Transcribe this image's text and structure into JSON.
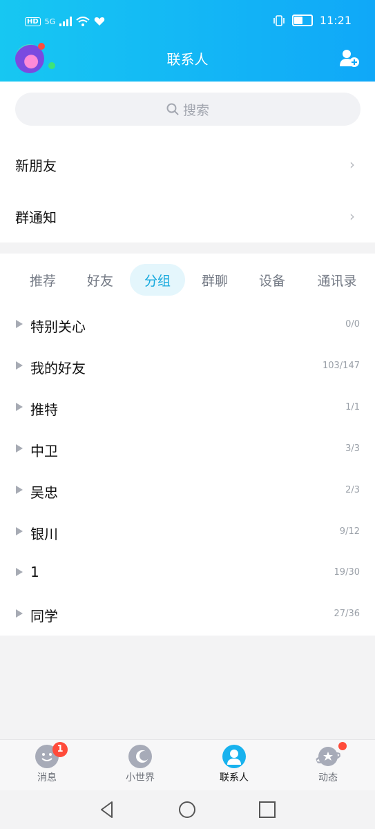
{
  "status_bar": {
    "hd": "HD",
    "net": "5G",
    "time": "11:21"
  },
  "header": {
    "title": "联系人"
  },
  "search": {
    "placeholder": "搜索"
  },
  "entries": [
    {
      "label": "新朋友"
    },
    {
      "label": "群通知"
    }
  ],
  "tabs": [
    {
      "label": "推荐",
      "active": false
    },
    {
      "label": "好友",
      "active": false
    },
    {
      "label": "分组",
      "active": true
    },
    {
      "label": "群聊",
      "active": false
    },
    {
      "label": "设备",
      "active": false
    },
    {
      "label": "通讯录",
      "active": false
    }
  ],
  "groups": [
    {
      "name": "特别关心",
      "count": "0/0"
    },
    {
      "name": "我的好友",
      "count": "103/147"
    },
    {
      "name": "推特",
      "count": "1/1"
    },
    {
      "name": "中卫",
      "count": "3/3"
    },
    {
      "name": "吴忠",
      "count": "2/3"
    },
    {
      "name": "银川",
      "count": "9/12"
    },
    {
      "name": "1",
      "count": "19/30"
    },
    {
      "name": "同学",
      "count": "27/36"
    }
  ],
  "bottom_nav": {
    "messages_badge": "1",
    "items": [
      {
        "label": "消息",
        "icon": "messages-icon"
      },
      {
        "label": "小世界",
        "icon": "small-world-icon"
      },
      {
        "label": "联系人",
        "icon": "contacts-icon",
        "active": true
      },
      {
        "label": "动态",
        "icon": "feed-icon"
      }
    ]
  },
  "colors": {
    "accent": "#14a8dd",
    "header_start": "#17c7f2",
    "header_end": "#10a8f8",
    "badge": "#ff4b3a"
  }
}
